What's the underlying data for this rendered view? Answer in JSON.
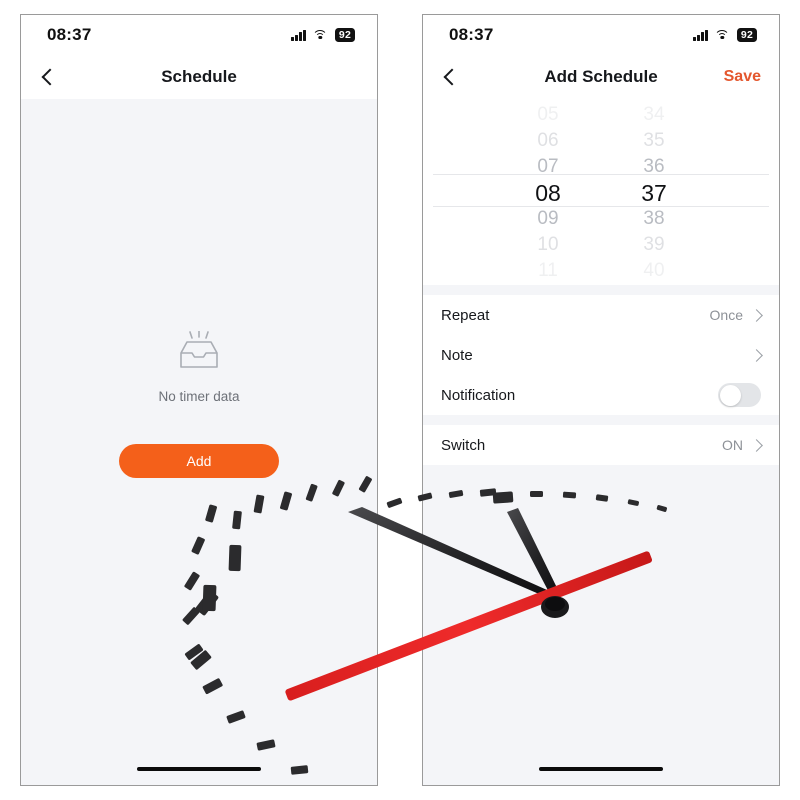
{
  "screens": {
    "left": {
      "status": {
        "time": "08:37",
        "battery": "92",
        "signal_icon": "signal-bars-icon",
        "wifi_icon": "wifi-icon"
      },
      "nav": {
        "back_icon": "chevron-left-icon",
        "title": "Schedule"
      },
      "empty_state": {
        "icon": "empty-inbox-icon",
        "text": "No timer data"
      },
      "add_button": {
        "label": "Add",
        "color": "#f4601a"
      }
    },
    "right": {
      "status": {
        "time": "08:37",
        "battery": "92",
        "signal_icon": "signal-bars-icon",
        "wifi_icon": "wifi-icon"
      },
      "nav": {
        "back_icon": "chevron-left-icon",
        "title": "Add Schedule",
        "action_label": "Save",
        "action_color": "#e4572e"
      },
      "picker": {
        "hours": [
          "05",
          "06",
          "07",
          "08",
          "09",
          "10",
          "11"
        ],
        "minutes": [
          "34",
          "35",
          "36",
          "37",
          "38",
          "39",
          "40"
        ],
        "selected_hour": "08",
        "selected_minute": "37",
        "selected_index": 3
      },
      "settings": [
        {
          "label": "Repeat",
          "value": "Once",
          "control": "chevron"
        },
        {
          "label": "Note",
          "value": "",
          "control": "chevron"
        },
        {
          "label": "Notification",
          "value": "",
          "control": "toggle-off"
        }
      ],
      "settings_group_2": [
        {
          "label": "Switch",
          "value": "ON",
          "control": "chevron"
        }
      ]
    }
  },
  "overlay": {
    "name": "analog-clock-photo",
    "hand_color": "#2b2b2d",
    "second_hand_color": "#e02020",
    "tick_color": "#2b2b2d"
  }
}
